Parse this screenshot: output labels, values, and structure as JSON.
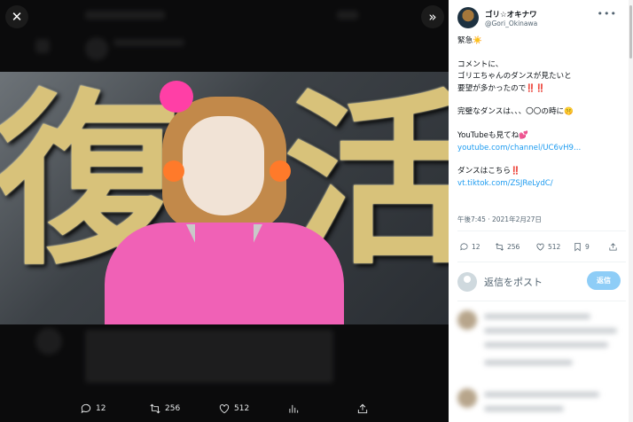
{
  "viewer": {
    "close_icon": "close-icon",
    "expand_icon": "chevrons-right-icon",
    "image": {
      "kanji_left": "復",
      "kanji_right": "活"
    },
    "actions": [
      {
        "icon": "reply-icon",
        "count": "12"
      },
      {
        "icon": "retweet-icon",
        "count": "256"
      },
      {
        "icon": "like-icon",
        "count": "512"
      },
      {
        "icon": "analytics-icon",
        "count": ""
      },
      {
        "icon": "share-icon",
        "count": ""
      }
    ]
  },
  "post": {
    "author_name": "ゴリ☆オキナワ",
    "author_handle": "@Gori_Okinawa",
    "lines": [
      "緊急☀️",
      "",
      "コメントに、",
      "ゴリエちゃんのダンスが見たいと",
      "要望が多かったので‼️‼️",
      "",
      "完璧なダンスは、、、〇〇の時に🤫",
      "",
      "YouTubeも見てね💕"
    ],
    "link1": "youtube.com/channel/UC6vH9...",
    "line_after_link": "ダンスはこちら‼️",
    "link2": "vt.tiktok.com/ZSJReLydC/",
    "timestamp": "午後7:45 · 2021年2月27日",
    "stats": {
      "replies": "12",
      "retweets": "256",
      "likes": "512",
      "bookmarks": "9"
    },
    "reply_placeholder": "返信をポスト",
    "reply_button": "返信"
  },
  "colors": {
    "accent": "#1d9bf0",
    "reply_button_disabled": "#8ecdf7",
    "dark_bg": "#000000"
  }
}
